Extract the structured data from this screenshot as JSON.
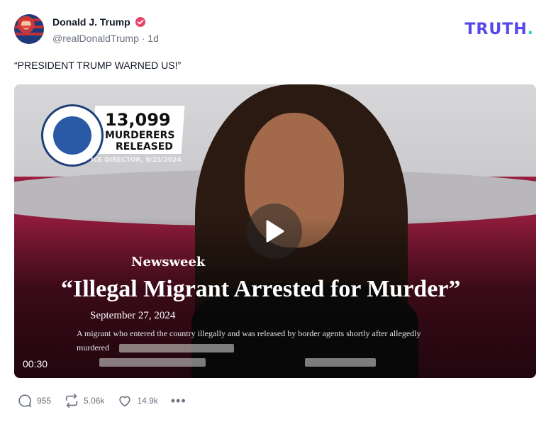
{
  "post": {
    "author_name": "Donald J. Trump",
    "handle_time": "@realDonaldTrump · 1d",
    "text": "“PRESIDENT TRUMP WARNED US!”",
    "verified_icon": "verified-badge-icon"
  },
  "brand": {
    "logo_text": "TRUTH",
    "logo_dot": ".",
    "accent": "#5448ee",
    "dot_color": "#2dd4bf"
  },
  "media": {
    "ice_number": "13,099",
    "ice_line1": "MURDERERS",
    "ice_line2": "RELEASED",
    "ice_source": "ICE DIRECTOR, 9/25/2024",
    "outlet": "Newsweek",
    "headline": "“Illegal Migrant Arrested for Murder”",
    "dateline": "September 27, 2024",
    "body_line1": "A migrant who entered the country illegally and was released by border agents shortly after allegedly",
    "body_line2": "murdered",
    "duration": "00:30",
    "play_icon": "play-icon"
  },
  "actions": {
    "replies": "955",
    "retruths": "5.06k",
    "likes": "14.9k",
    "more_label": "•••"
  }
}
